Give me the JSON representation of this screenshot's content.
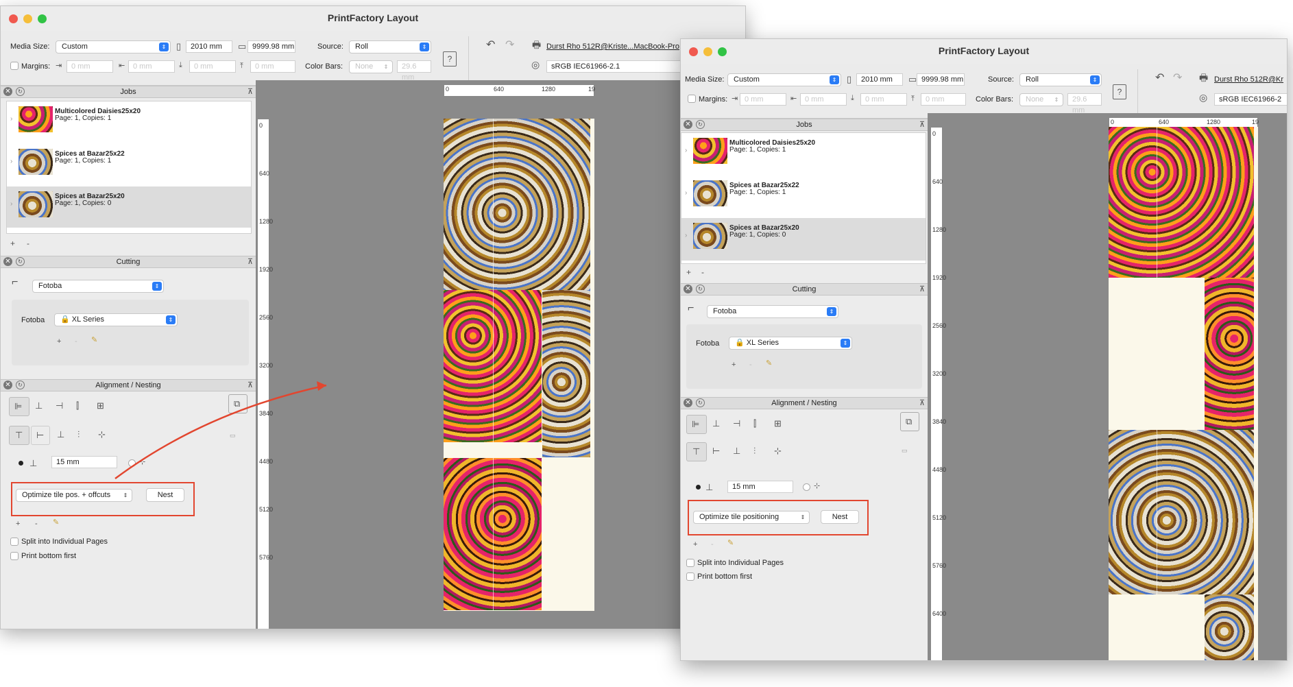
{
  "app": {
    "title": "PrintFactory Layout"
  },
  "toolbar": {
    "media_size_label": "Media Size:",
    "media_size_value": "Custom",
    "width_value": "2010 mm",
    "height_value": "9999.98 mm",
    "source_label": "Source:",
    "source_value": "Roll",
    "margins_label": "Margins:",
    "margin_values": [
      "0 mm",
      "0 mm",
      "0 mm",
      "0 mm"
    ],
    "color_bars_label": "Color Bars:",
    "color_bars_value": "None",
    "color_bars_size": "29.6 mm",
    "printer_back": "Durst Rho 512R@Kriste...MacBook-Pro",
    "printer_front": "Durst Rho 512R@Kr",
    "profile_back": "sRGB IEC61966-2.1",
    "profile_front": "sRGB IEC61966-2"
  },
  "jobs_panel": {
    "title": "Jobs",
    "items": [
      {
        "name": "Multicolored Daisies25x20",
        "info": "Page: 1, Copies: 1"
      },
      {
        "name": "Spices at Bazar25x22",
        "info": "Page: 1, Copies: 1"
      },
      {
        "name": "Spices at Bazar25x20",
        "info": "Page: 1, Copies: 0"
      }
    ],
    "add": "+",
    "remove": "-"
  },
  "cutting_panel": {
    "title": "Cutting",
    "cutter": "Fotoba",
    "device_label": "Fotoba",
    "device_value": "XL Series"
  },
  "alignment_panel": {
    "title": "Alignment / Nesting",
    "spacing_value": "15 mm",
    "nest_button": "Nest",
    "nest_mode_back": "Optimize tile pos. + offcuts",
    "nest_mode_front": "Optimize tile positioning",
    "split_label": "Split into Individual Pages",
    "print_bottom_label": "Print bottom first"
  },
  "rulers": {
    "h_back": [
      "0",
      "640",
      "1280",
      "19"
    ],
    "v_back": [
      "0",
      "640",
      "1280",
      "1920",
      "2560",
      "3200",
      "3840",
      "4480",
      "5120",
      "5760"
    ],
    "h_front": [
      "0",
      "640",
      "1280",
      "19"
    ],
    "v_front": [
      "0",
      "640",
      "1280",
      "1920",
      "2560",
      "3200",
      "3840",
      "4480",
      "5120",
      "5760",
      "6400"
    ]
  },
  "colors": {
    "annotation": "#e2462f",
    "accent": "#2a7cf6",
    "canvas": "#8a8a8a"
  }
}
